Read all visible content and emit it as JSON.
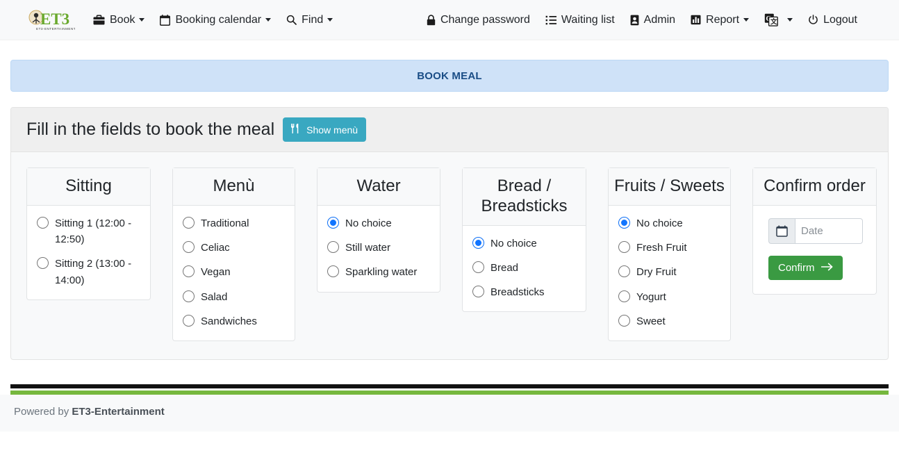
{
  "navbar": {
    "brand": {
      "text": "ET3",
      "subtext": "ENTERTAINMENT",
      "color": "#6aa92e"
    },
    "left_items": [
      {
        "label": "Book",
        "icon": "briefcase-icon",
        "caret": true
      },
      {
        "label": "Booking calendar",
        "icon": "calendar-icon",
        "caret": true
      },
      {
        "label": "Find",
        "icon": "search-icon",
        "caret": true
      }
    ],
    "right_items": [
      {
        "label": "Change password",
        "icon": "lock-icon",
        "caret": false
      },
      {
        "label": "Waiting list",
        "icon": "list-ol-icon",
        "caret": false
      },
      {
        "label": "Admin",
        "icon": "id-card-icon",
        "caret": false
      },
      {
        "label": "Report",
        "icon": "chart-bar-icon",
        "caret": true
      },
      {
        "label": "",
        "icon": "translate-icon",
        "caret": true
      },
      {
        "label": "Logout",
        "icon": "power-icon",
        "caret": false
      }
    ]
  },
  "banner": {
    "text": "BOOK MEAL",
    "bg": "#cfe2f8",
    "color": "#1a4d86"
  },
  "card": {
    "title": "Fill in the fields to book the meal",
    "show_menu_button": {
      "label": "Show menù",
      "icon": "utensils-icon",
      "color": "#39a8c1"
    }
  },
  "panels": [
    {
      "name": "sitting",
      "title": "Sitting",
      "options": [
        {
          "label": "Sitting 1 (12:00 - 12:50)",
          "checked": false
        },
        {
          "label": "Sitting 2 (13:00 - 14:00)",
          "checked": false
        }
      ]
    },
    {
      "name": "menu",
      "title": "Menù",
      "options": [
        {
          "label": "Traditional",
          "checked": false
        },
        {
          "label": "Celiac",
          "checked": false
        },
        {
          "label": "Vegan",
          "checked": false
        },
        {
          "label": "Salad",
          "checked": false
        },
        {
          "label": "Sandwiches",
          "checked": false
        }
      ]
    },
    {
      "name": "water",
      "title": "Water",
      "options": [
        {
          "label": "No choice",
          "checked": true
        },
        {
          "label": "Still water",
          "checked": false
        },
        {
          "label": "Sparkling water",
          "checked": false
        }
      ]
    },
    {
      "name": "bread",
      "title": "Bread / Breadsticks",
      "options": [
        {
          "label": "No choice",
          "checked": true
        },
        {
          "label": "Bread",
          "checked": false
        },
        {
          "label": "Breadsticks",
          "checked": false
        }
      ]
    },
    {
      "name": "fruits",
      "title": "Fruits / Sweets",
      "options": [
        {
          "label": "No choice",
          "checked": true
        },
        {
          "label": "Fresh Fruit",
          "checked": false
        },
        {
          "label": "Dry Fruit",
          "checked": false
        },
        {
          "label": "Yogurt",
          "checked": false
        },
        {
          "label": "Sweet",
          "checked": false
        }
      ]
    }
  ],
  "confirm": {
    "title": "Confirm order",
    "date_placeholder": "Date",
    "date_value": "",
    "date_icon": "calendar-icon",
    "button_label": "Confirm",
    "button_icon": "arrow-right-icon",
    "button_color": "#3a9a42"
  },
  "footer": {
    "prefix": "Powered by ",
    "brand": "ET3-Entertainment",
    "bar_black": "#111111",
    "bar_green": "#76b83e"
  }
}
